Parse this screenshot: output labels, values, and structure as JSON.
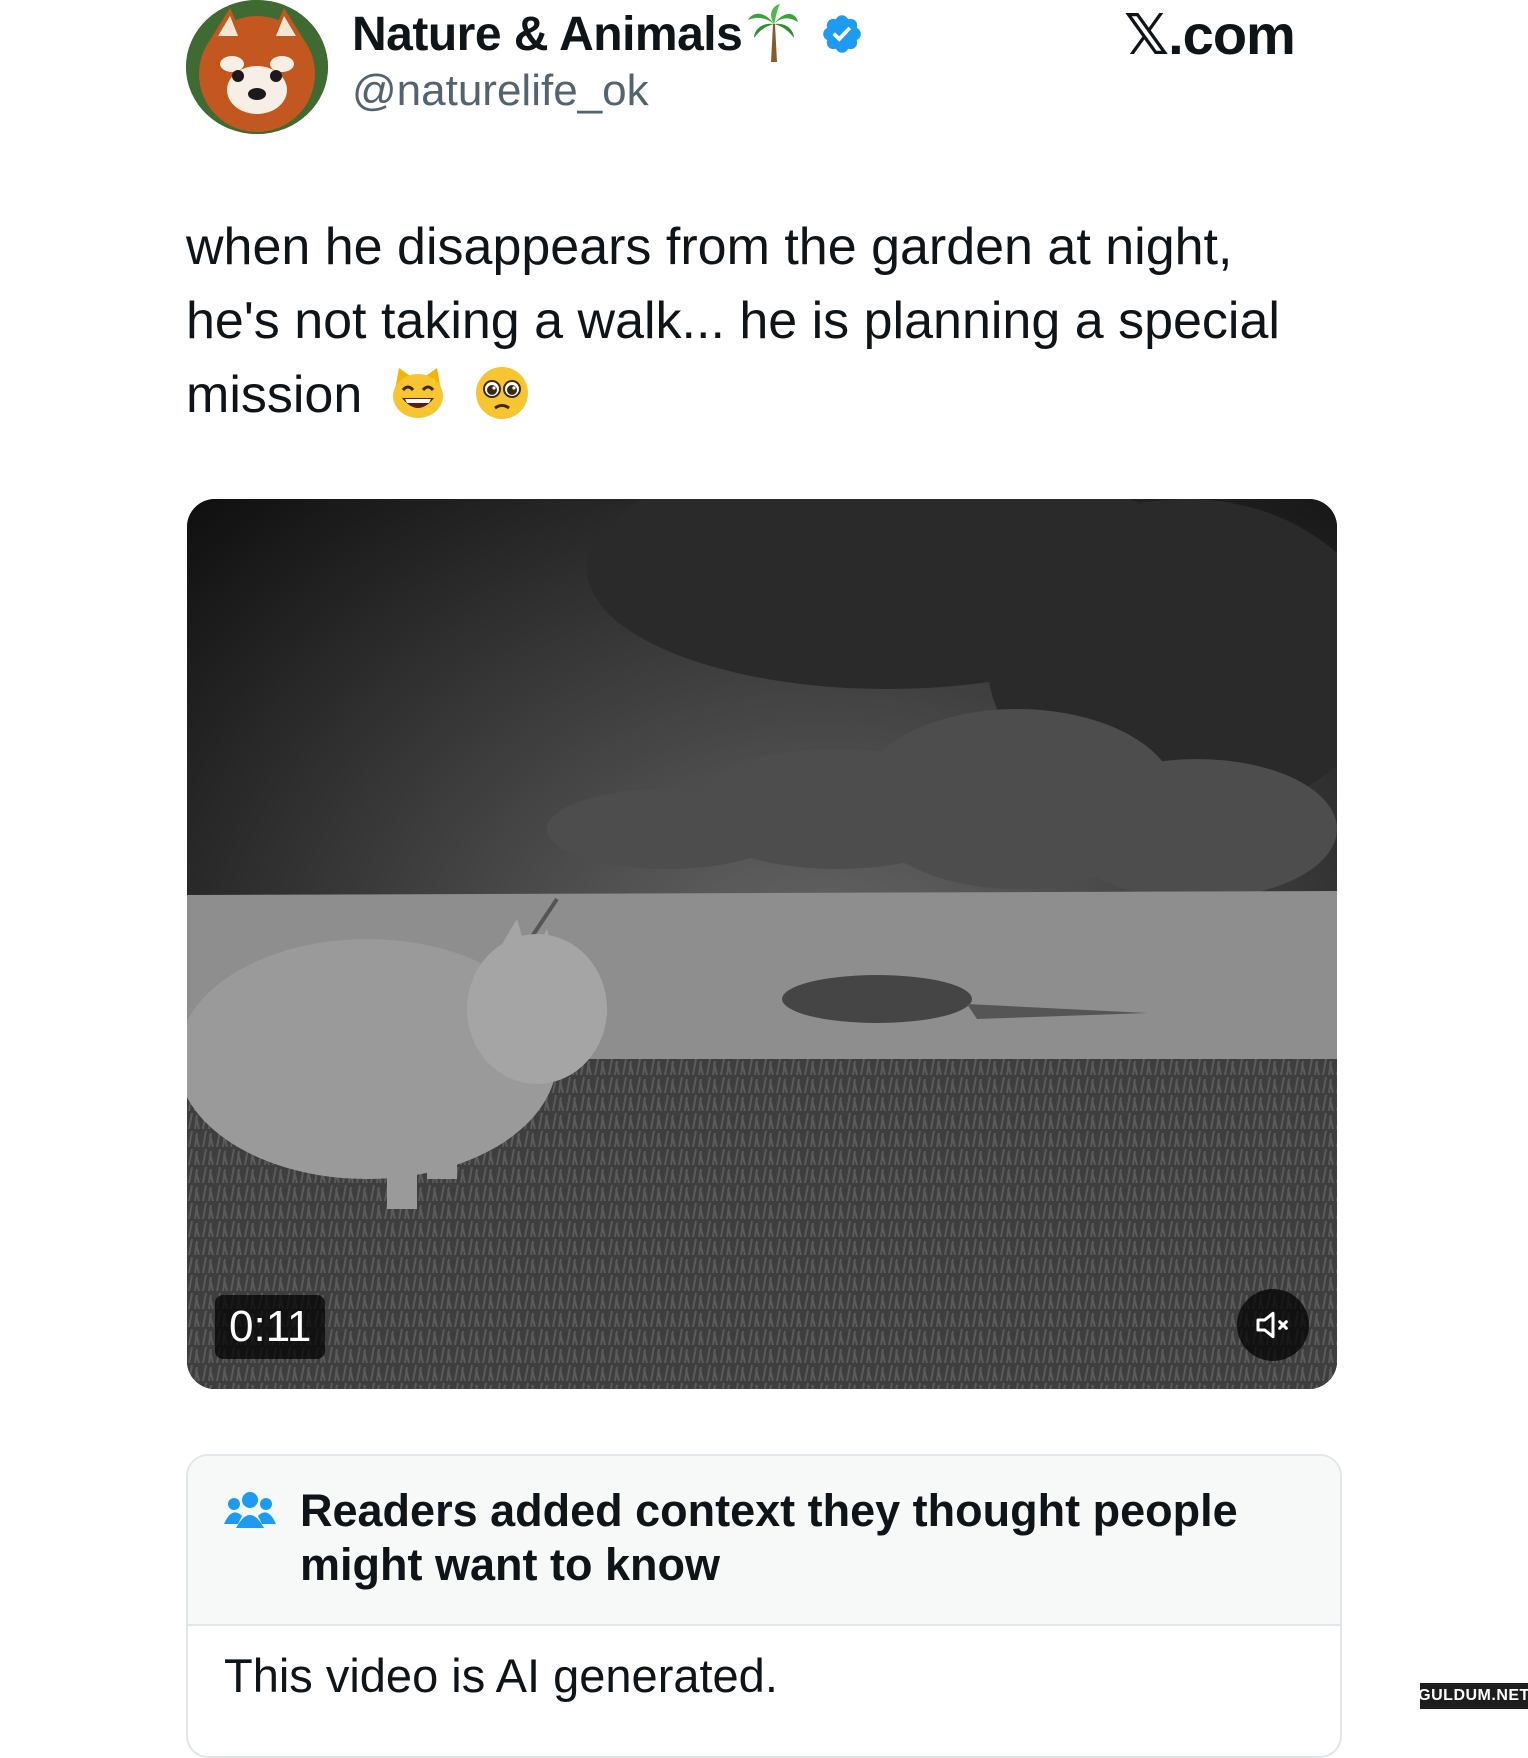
{
  "author": {
    "display_name": "Nature & Animals",
    "handle": "@naturelife_ok",
    "verified": true,
    "name_emoji": "palm-tree-icon",
    "avatar": "red-panda-avatar"
  },
  "brand": "𝕏.com",
  "tweet": {
    "text": "when he disappears from the garden at night, he's not taking a walk... he is planning a special mission",
    "emojis": [
      "grinning-cat-icon",
      "pleading-face-icon"
    ]
  },
  "video": {
    "duration": "0:11",
    "muted": true
  },
  "community_note": {
    "title": "Readers added context they thought people might want to know",
    "body": "This video is AI generated."
  },
  "watermark": "GULDUM.NET",
  "colors": {
    "verified": "#1d9bf0",
    "handle": "#536471",
    "note_icon": "#1d9bf0"
  }
}
